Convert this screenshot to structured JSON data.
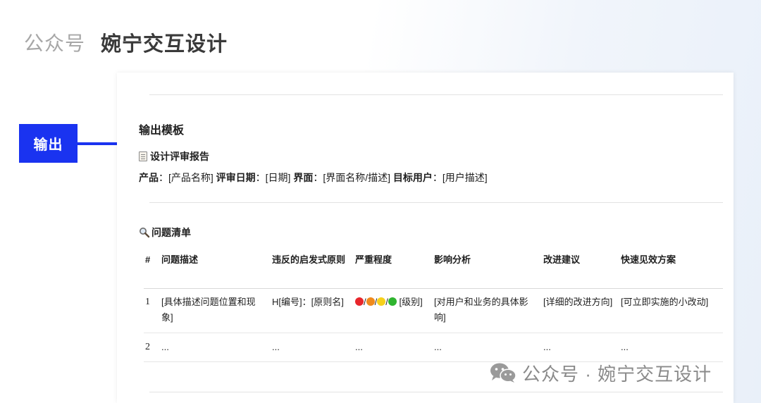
{
  "header": {
    "label": "公众号",
    "name": "婉宁交互设计"
  },
  "side_tag": "输出",
  "doc": {
    "section_title": "输出模板",
    "report_title": "设计评审报告",
    "meta": {
      "product_label": "产品",
      "product_value": "：[产品名称] ",
      "date_label": "评审日期",
      "date_value": "：[日期] ",
      "ui_label": "界面",
      "ui_value": "：[界面名称/描述] ",
      "user_label": "目标用户",
      "user_value": "：[用户描述]"
    },
    "issues_title": "问题清单",
    "table": {
      "headers": [
        "#",
        "问题描述",
        "违反的启发式原则",
        "严重程度",
        "影响分析",
        "改进建议",
        "快速见效方案"
      ],
      "rows": [
        {
          "num": "1",
          "desc": "[具体描述问题位置和现象]",
          "principle": "H[编号]：[原则名]",
          "severity_suffix": "[级别]",
          "impact": "[对用户和业务的具体影响]",
          "suggestion": "[详细的改进方向]",
          "quick_fix": "[可立即实施的小改动]"
        },
        {
          "num": "2",
          "desc": "...",
          "principle": "...",
          "severity": "...",
          "impact": "...",
          "suggestion": "...",
          "quick_fix": "..."
        }
      ],
      "severity_colors": [
        "#e8262b",
        "#f08a1c",
        "#f7d11b",
        "#2fb42f"
      ],
      "severity_separator": "/"
    }
  },
  "watermark": {
    "icon": "wechat-icon",
    "text": "公众号 · 婉宁交互设计"
  },
  "colors": {
    "accent": "#1a33f0"
  }
}
